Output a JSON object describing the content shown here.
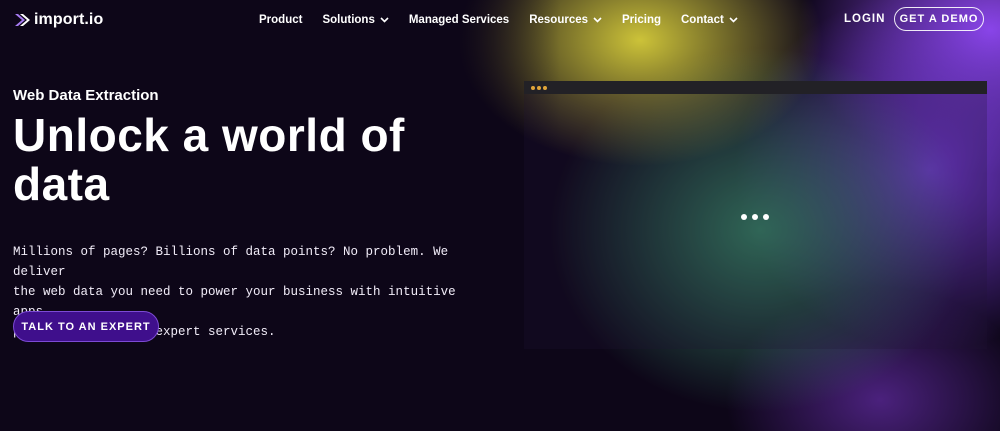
{
  "brand": {
    "name": "import.io",
    "logo_icon": "chevron-logo-icon"
  },
  "nav": {
    "items": [
      {
        "label": "Product",
        "dropdown": false
      },
      {
        "label": "Solutions",
        "dropdown": true
      },
      {
        "label": "Managed Services",
        "dropdown": false
      },
      {
        "label": "Resources",
        "dropdown": true
      },
      {
        "label": "Pricing",
        "dropdown": false
      },
      {
        "label": "Contact",
        "dropdown": true
      }
    ],
    "login_label": "LOGIN",
    "demo_label": "GET A DEMO"
  },
  "hero": {
    "eyebrow": "Web Data Extraction",
    "title_line1": "Unlock a world of",
    "title_line2": "data",
    "description_line1": "Millions of pages? Billions of data points? No problem. We deliver",
    "description_line2": "the web data you need to power your business with intuitive apps,",
    "description_line3": "powerful APIs, and expert services.",
    "cta_label": "TALK TO AN EXPERT"
  },
  "preview_window": {
    "window_dots": [
      "#e0a53a",
      "#e0a53a",
      "#e0a53a"
    ],
    "loader": "loading-dots"
  },
  "colors": {
    "background": "#0d0618",
    "cta_fill": "#3f0f8c",
    "accent_purple": "#7b3fe4"
  }
}
